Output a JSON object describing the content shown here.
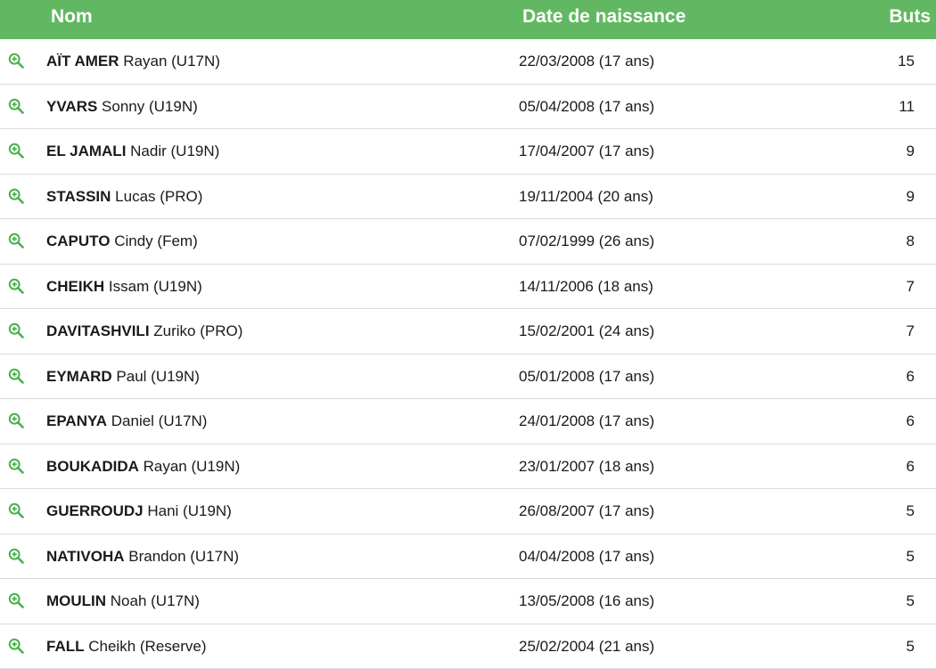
{
  "header": {
    "name": "Nom",
    "birthdate": "Date de naissance",
    "goals": "Buts"
  },
  "accent_color": "#62b862",
  "icon": "zoom-in-icon",
  "players": [
    {
      "last": "AÏT AMER",
      "rest": "Rayan (U17N)",
      "birth": "22/03/2008 (17 ans)",
      "goals": "15"
    },
    {
      "last": "YVARS",
      "rest": "Sonny (U19N)",
      "birth": "05/04/2008 (17 ans)",
      "goals": "11"
    },
    {
      "last": "EL JAMALI",
      "rest": "Nadir (U19N)",
      "birth": "17/04/2007 (17 ans)",
      "goals": "9"
    },
    {
      "last": "STASSIN",
      "rest": "Lucas (PRO)",
      "birth": "19/11/2004 (20 ans)",
      "goals": "9"
    },
    {
      "last": "CAPUTO",
      "rest": "Cindy (Fem)",
      "birth": "07/02/1999 (26 ans)",
      "goals": "8"
    },
    {
      "last": "CHEIKH",
      "rest": "Issam (U19N)",
      "birth": "14/11/2006 (18 ans)",
      "goals": "7"
    },
    {
      "last": "DAVITASHVILI",
      "rest": "Zuriko (PRO)",
      "birth": "15/02/2001 (24 ans)",
      "goals": "7"
    },
    {
      "last": "EYMARD",
      "rest": "Paul (U19N)",
      "birth": "05/01/2008 (17 ans)",
      "goals": "6"
    },
    {
      "last": "EPANYA",
      "rest": "Daniel (U17N)",
      "birth": "24/01/2008 (17 ans)",
      "goals": "6"
    },
    {
      "last": "BOUKADIDA",
      "rest": "Rayan (U19N)",
      "birth": "23/01/2007 (18 ans)",
      "goals": "6"
    },
    {
      "last": "GUERROUDJ",
      "rest": "Hani (U19N)",
      "birth": "26/08/2007 (17 ans)",
      "goals": "5"
    },
    {
      "last": "NATIVOHA",
      "rest": "Brandon (U17N)",
      "birth": "04/04/2008 (17 ans)",
      "goals": "5"
    },
    {
      "last": "MOULIN",
      "rest": "Noah (U17N)",
      "birth": "13/05/2008 (16 ans)",
      "goals": "5"
    },
    {
      "last": "FALL",
      "rest": "Cheikh (Reserve)",
      "birth": "25/02/2004 (21 ans)",
      "goals": "5"
    }
  ]
}
